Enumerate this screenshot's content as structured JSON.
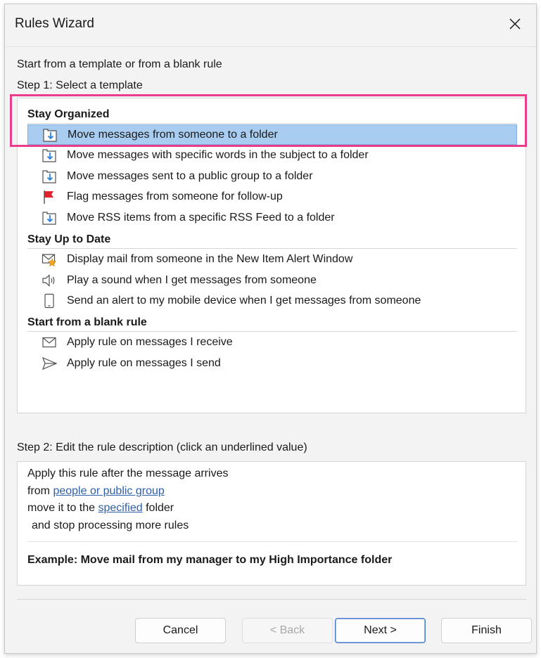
{
  "window": {
    "title": "Rules Wizard"
  },
  "intro": "Start from a template or from a blank rule",
  "step1": "Step 1: Select a template",
  "groups": [
    {
      "header": "Stay Organized",
      "items": [
        {
          "label": "Move messages from someone to a folder",
          "icon": "move-to-folder-icon",
          "selected": true
        },
        {
          "label": "Move messages with specific words in the subject to a folder",
          "icon": "move-to-folder-icon"
        },
        {
          "label": "Move messages sent to a public group to a folder",
          "icon": "move-to-folder-icon"
        },
        {
          "label": "Flag messages from someone for follow-up",
          "icon": "flag-icon"
        },
        {
          "label": "Move RSS items from a specific RSS Feed to a folder",
          "icon": "move-to-folder-icon"
        }
      ]
    },
    {
      "header": "Stay Up to Date",
      "items": [
        {
          "label": "Display mail from someone in the New Item Alert Window",
          "icon": "new-item-alert-icon"
        },
        {
          "label": "Play a sound when I get messages from someone",
          "icon": "speaker-icon"
        },
        {
          "label": "Send an alert to my mobile device when I get messages from someone",
          "icon": "mobile-device-icon"
        }
      ]
    },
    {
      "header": "Start from a blank rule",
      "items": [
        {
          "label": "Apply rule on messages I receive",
          "icon": "envelope-icon"
        },
        {
          "label": "Apply rule on messages I send",
          "icon": "send-icon"
        }
      ]
    }
  ],
  "step2": "Step 2: Edit the rule description (click an underlined value)",
  "description": {
    "line1": "Apply this rule after the message arrives",
    "line2_prefix": "from ",
    "line2_link": "people or public group",
    "line3_prefix": "move it to the ",
    "line3_link": "specified",
    "line3_suffix": " folder",
    "line4": "and stop processing more rules",
    "example": "Example: Move mail from my manager to my High Importance folder"
  },
  "buttons": {
    "cancel": "Cancel",
    "back": "< Back",
    "next": "Next >",
    "finish": "Finish"
  },
  "colors": {
    "selection": "#a9cdf0",
    "highlight_box": "#e83e8c",
    "link": "#2f5fa6",
    "flag": "#e0222c",
    "folder_arrow": "#2a7fd6"
  }
}
